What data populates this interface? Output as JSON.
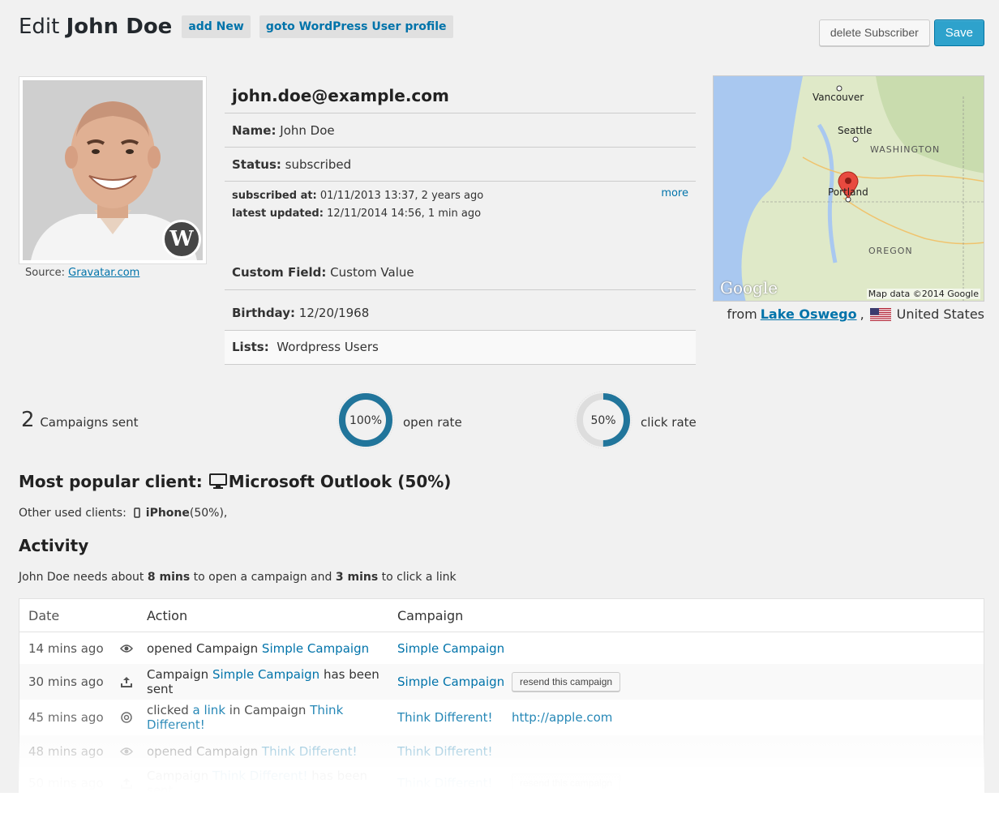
{
  "header": {
    "title_prefix": "Edit",
    "title_name": "John Doe",
    "add_new": "add New",
    "goto_profile": "goto WordPress User profile",
    "delete_button": "delete Subscriber",
    "save_button": "Save"
  },
  "avatar": {
    "source_label": "Source:",
    "source_link": "Gravatar.com"
  },
  "details": {
    "email": "john.doe@example.com",
    "name_label": "Name:",
    "name_value": "John Doe",
    "status_label": "Status:",
    "status_value": "subscribed",
    "subscribed_label": "subscribed at:",
    "subscribed_value": "01/11/2013 13:37, 2 years ago",
    "updated_label": "latest updated:",
    "updated_value": "12/11/2014 14:56, 1 min ago",
    "more_link": "more",
    "custom_label": "Custom Field:",
    "custom_value": "Custom Value",
    "birthday_label": "Birthday:",
    "birthday_value": "12/20/1968",
    "lists_label": "Lists:",
    "lists_value": "Wordpress Users"
  },
  "map": {
    "labels": {
      "vancouver": "Vancouver",
      "seattle": "Seattle",
      "washington": "WASHINGTON",
      "portland": "Portland",
      "oregon": "OREGON"
    },
    "google": "Google",
    "copyright": "Map data ©2014 Google",
    "from_label": "from",
    "city": "Lake Oswego",
    "country": "United States"
  },
  "stats": {
    "campaigns_sent_count": "2",
    "campaigns_sent_label": "Campaigns sent",
    "open_rate_value": 100,
    "open_rate_text": "100%",
    "open_rate_label": "open rate",
    "click_rate_value": 50,
    "click_rate_text": "50%",
    "click_rate_label": "click rate",
    "gauge_color": "#21759b",
    "gauge_track": "#dddddd"
  },
  "clients": {
    "popular_label": "Most popular client:",
    "popular_value": "Microsoft Outlook (50%)",
    "popular_icon": "desktop-icon",
    "other_label": "Other used clients:",
    "other_icon": "mobile-icon",
    "other_name": "iPhone",
    "other_value": "(50%),"
  },
  "activity": {
    "title": "Activity",
    "desc_1": "John Doe needs about",
    "open_time": "8 mins",
    "desc_2": "to open a campaign and",
    "click_time": "3 mins",
    "desc_3": "to click a link",
    "columns": [
      "Date",
      "Action",
      "Campaign"
    ],
    "rows": [
      {
        "date": "14 mins ago",
        "icon": "eye-icon",
        "pre": "opened Campaign",
        "link": "Simple Campaign",
        "mid": "",
        "link2": "",
        "post": "",
        "campaign": "Simple Campaign",
        "extra_link": "",
        "resend": ""
      },
      {
        "date": "30 mins ago",
        "icon": "upload-icon",
        "pre": "Campaign",
        "link": "Simple Campaign",
        "mid": "",
        "link2": "",
        "post": "has been sent",
        "campaign": "Simple Campaign",
        "extra_link": "",
        "resend": "resend this campaign"
      },
      {
        "date": "45 mins ago",
        "icon": "at-icon",
        "pre": "clicked",
        "link": "a link",
        "mid": "in Campaign",
        "link2": "Think Different!",
        "post": "",
        "campaign": "Think Different!",
        "extra_link": "http://apple.com",
        "resend": ""
      },
      {
        "date": "48 mins ago",
        "icon": "eye-icon",
        "pre": "opened Campaign",
        "link": "Think Different!",
        "mid": "",
        "link2": "",
        "post": "",
        "campaign": "Think Different!",
        "extra_link": "",
        "resend": ""
      },
      {
        "date": "50 mins ago",
        "icon": "upload-icon",
        "pre": "Campaign",
        "link": "Think Different!",
        "mid": "",
        "link2": "",
        "post": "has been sent",
        "campaign": "Think Different!",
        "extra_link": "",
        "resend": "resend this campaign"
      }
    ]
  }
}
